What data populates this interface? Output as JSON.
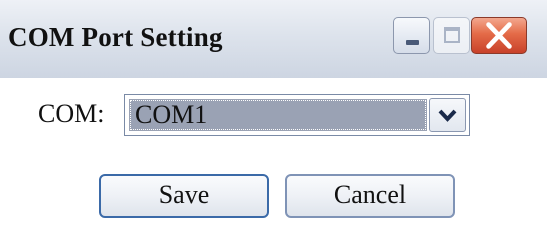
{
  "window": {
    "title": "COM Port Setting"
  },
  "titlebar_buttons": {
    "minimize": "minimize-icon",
    "maximize": "maximize-icon",
    "close": "close-icon"
  },
  "com": {
    "label": "COM:",
    "selected": "COM1"
  },
  "actions": {
    "save_label": "Save",
    "cancel_label": "Cancel"
  },
  "colors": {
    "close_button": "#e46b48",
    "selection_highlight": "#9aa2b4",
    "default_button_border": "#3b6aa8"
  }
}
